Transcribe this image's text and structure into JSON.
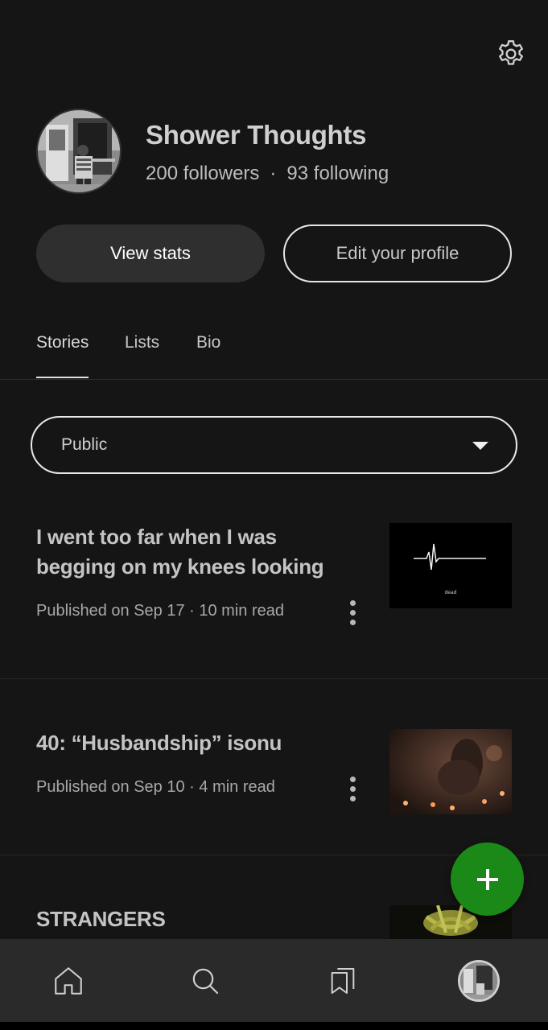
{
  "header": {
    "settings_icon": "gear-icon"
  },
  "profile": {
    "name": "Shower Thoughts",
    "followers": "200 followers",
    "separator": "·",
    "following": "93 following"
  },
  "actions": {
    "view_stats_label": "View stats",
    "edit_profile_label": "Edit your profile"
  },
  "tabs": [
    {
      "label": "Stories",
      "active": true
    },
    {
      "label": "Lists",
      "active": false
    },
    {
      "label": "Bio",
      "active": false
    }
  ],
  "filter": {
    "selected": "Public"
  },
  "stories": [
    {
      "title": "I went too far when I was begging on my knees looking",
      "meta": "Published on Sep 17 · 10 min read",
      "thumb_caption": "dead"
    },
    {
      "title": "40: “Husbandship” isonu",
      "meta": "Published on Sep 10 · 4 min read"
    },
    {
      "title": "STRANGERS"
    }
  ],
  "colors": {
    "background": "#151515",
    "fab_green": "#1a8917",
    "nav_bg": "#2a2a2a"
  },
  "bottom_nav": [
    "home-icon",
    "search-icon",
    "bookmarks-icon",
    "profile-avatar"
  ]
}
